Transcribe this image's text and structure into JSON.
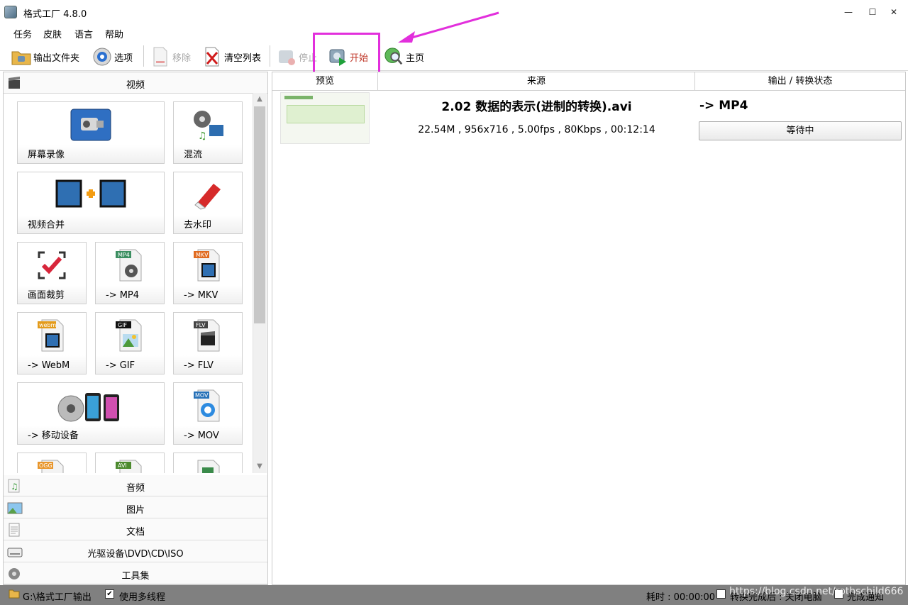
{
  "window": {
    "title": "格式工厂 4.8.0",
    "minimize": "—",
    "maximize": "☐",
    "close": "✕"
  },
  "menu": [
    "任务",
    "皮肤",
    "语言",
    "帮助"
  ],
  "toolbar": {
    "output_folder": "输出文件夹",
    "options": "选项",
    "remove": "移除",
    "clear_list": "清空列表",
    "stop": "停止",
    "start": "开始",
    "home": "主页"
  },
  "categories": {
    "video": "视频",
    "audio": "音频",
    "image": "图片",
    "document": "文档",
    "disc": "光驱设备\\DVD\\CD\\ISO",
    "tools": "工具集"
  },
  "video_tiles": {
    "screen_record": "屏幕录像",
    "mux": "混流",
    "video_merge": "视频合并",
    "remove_watermark": "去水印",
    "crop": "画面裁剪",
    "to_mp4": "-> MP4",
    "to_mkv": "-> MKV",
    "to_webm": "-> WebM",
    "to_gif": "-> GIF",
    "to_flv": "-> FLV",
    "to_mobile": "-> 移动设备",
    "to_mov": "-> MOV",
    "badge_mp4": "MP4",
    "badge_mkv": "MKV",
    "badge_webm": "webm",
    "badge_gif": "GIF",
    "badge_flv": "FLV",
    "badge_mov": "MOV",
    "badge_ogg": "OGG",
    "badge_avi": "AVI"
  },
  "task_list": {
    "columns": [
      "预览",
      "来源",
      "输出 / 转换状态"
    ],
    "rows": [
      {
        "file_name": "2.02  数据的表示(进制的转换).avi",
        "info": "22.54M , 956x716 , 5.00fps , 80Kbps , 00:12:14",
        "output_format": "-> MP4",
        "status": "等待中"
      }
    ]
  },
  "statusbar": {
    "output_path": "G:\\格式工厂输出",
    "multithread_label": "使用多线程",
    "multithread_checked": "✔",
    "elapsed": "耗时 : 00:00:00",
    "after_convert": "转换完成后 : 关闭电脑",
    "notify": "完成通知"
  },
  "watermark": "https://blog.csdn.net/rothschild666",
  "colors": {
    "highlight": "#e22fdc",
    "start_label": "#c0392b",
    "statusbar_bg": "#808080"
  }
}
